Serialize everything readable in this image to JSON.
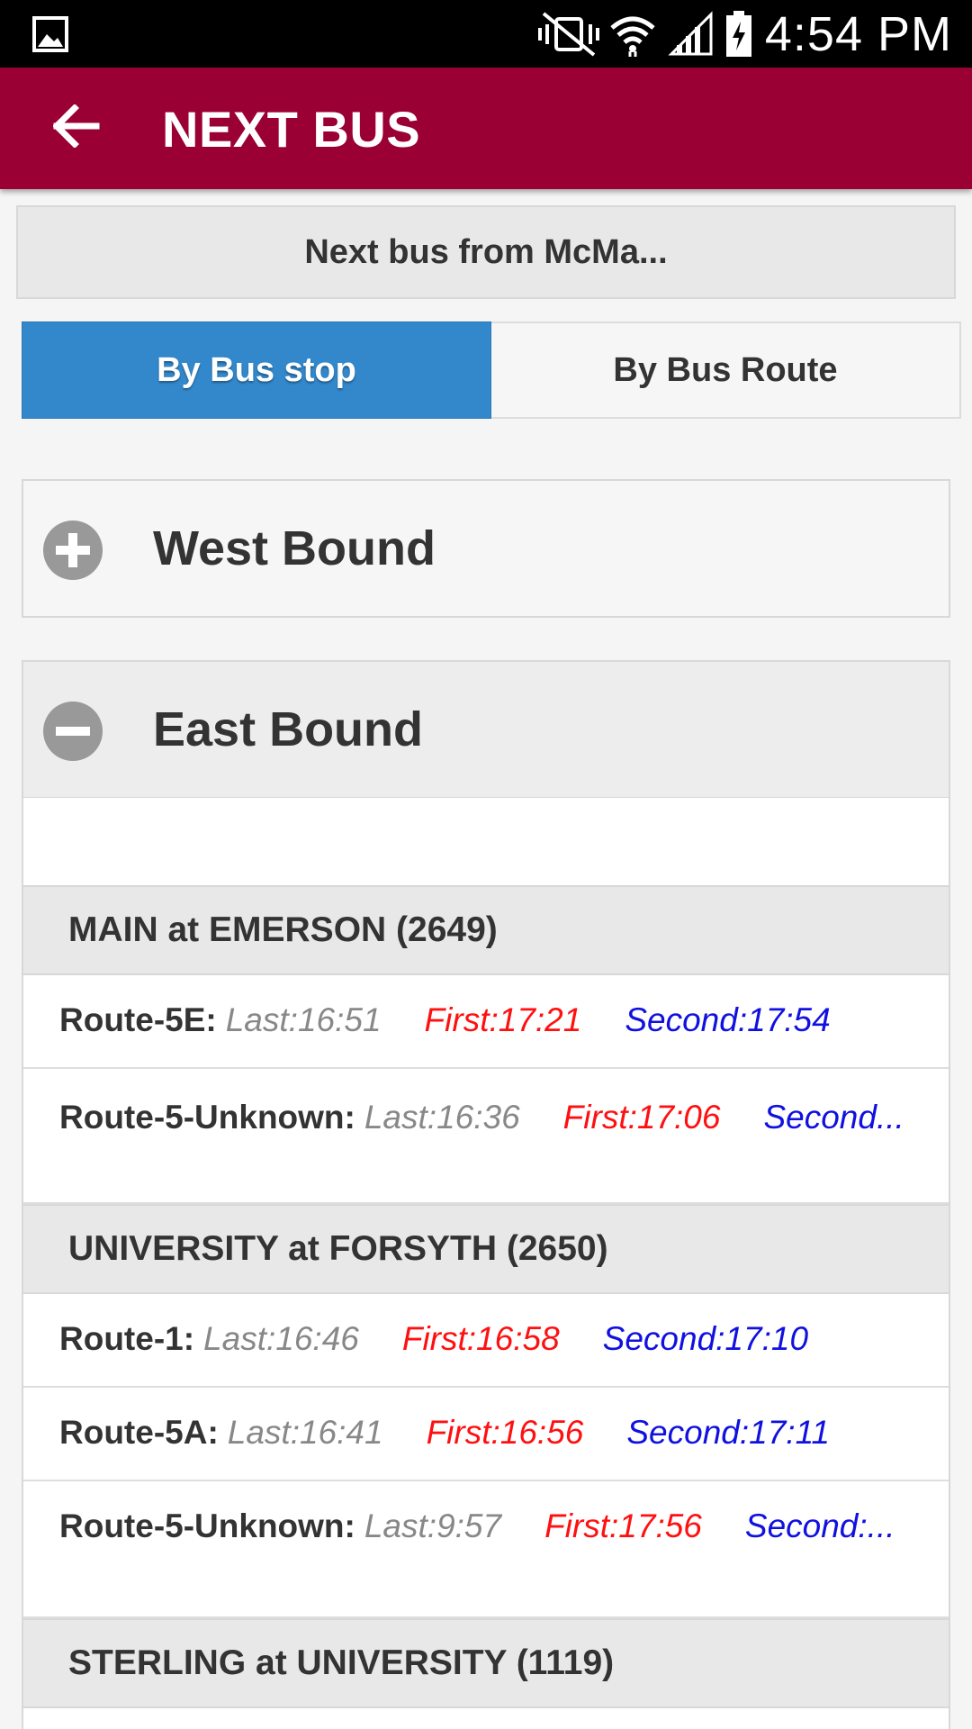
{
  "status_bar": {
    "time": "4:54 PM",
    "icons": [
      "image-icon",
      "vibrate-mute-icon",
      "wifi-icon",
      "cell-signal-icon",
      "battery-charging-icon"
    ]
  },
  "app_bar": {
    "title": "NEXT BUS",
    "back_icon": "arrow-left-icon",
    "color": "#9b0034"
  },
  "header_button": {
    "label": "Next bus from McMa..."
  },
  "tabs": [
    {
      "label": "By Bus stop",
      "active": true
    },
    {
      "label": "By Bus Route",
      "active": false
    }
  ],
  "sections": [
    {
      "title": "West Bound",
      "expanded": false,
      "icon": "plus-circle-icon"
    },
    {
      "title": "East Bound",
      "expanded": true,
      "icon": "minus-circle-icon"
    }
  ],
  "stops": [
    {
      "name": "MAIN at EMERSON (2649)",
      "routes": [
        {
          "name": "Route-5E:",
          "last": "Last:16:51",
          "first": "First:17:21",
          "second": "Second:17:54"
        },
        {
          "name": "Route-5-Unknown:",
          "last": "Last:16:36",
          "first": "First:17:06",
          "second": "Second..."
        }
      ]
    },
    {
      "name": "UNIVERSITY at FORSYTH (2650)",
      "routes": [
        {
          "name": "Route-1:",
          "last": "Last:16:46",
          "first": "First:16:58",
          "second": "Second:17:10"
        },
        {
          "name": "Route-5A:",
          "last": "Last:16:41",
          "first": "First:16:56",
          "second": "Second:17:11"
        },
        {
          "name": "Route-5-Unknown:",
          "last": "Last:9:57",
          "first": "First:17:56",
          "second": "Second:..."
        }
      ]
    },
    {
      "name": "STERLING at UNIVERSITY (1119)",
      "routes": []
    }
  ],
  "colors": {
    "tab_active": "#3388cc",
    "last_time": "#888888",
    "first_time": "#ff1010",
    "second_time": "#1010e0"
  }
}
